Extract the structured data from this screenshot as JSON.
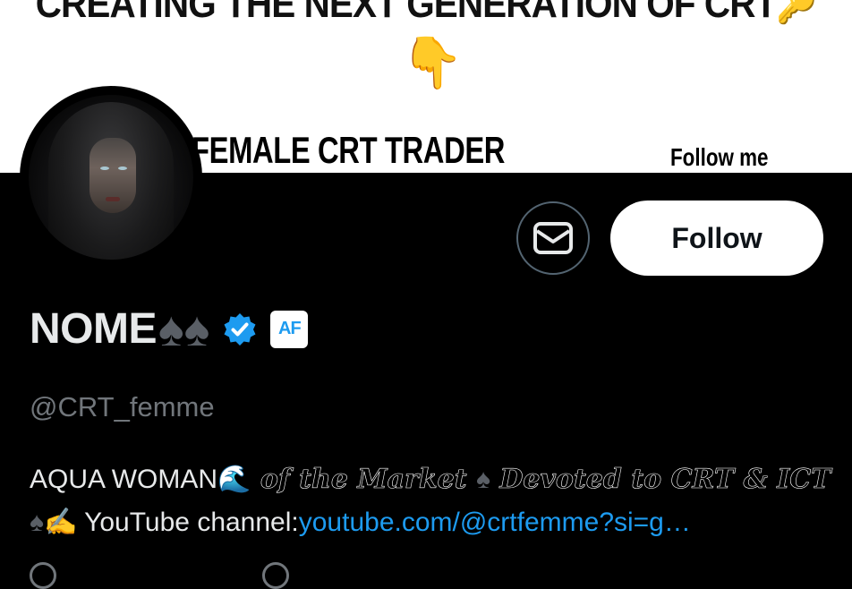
{
  "banner": {
    "headline": "CREATING THE NEXT GENERATION OF CRT",
    "headline_emoji": "🔑",
    "pointer_emoji": "👇",
    "subtitle": "FEMALE CRT TRADER",
    "follow_text": "Follow me"
  },
  "profile": {
    "name": "NOME",
    "name_suffix": "♠♠",
    "handle": "@CRT_femme",
    "affiliate_badge": "AF",
    "verified": true
  },
  "actions": {
    "follow_label": "Follow"
  },
  "bio": {
    "part1": "AQUA WOMAN",
    "wave_emoji": "🌊",
    "part2": " of the Market ",
    "spade1": "♠",
    "part3": " Devoted to CRT & ICT",
    "spade2": "♠",
    "writing_emoji": "✍",
    "part4": "  YouTube channel:",
    "link": "youtube.com/@crtfemme?si=g…"
  },
  "colors": {
    "background": "#000000",
    "accent": "#1d9bf0",
    "muted": "#71767b",
    "text": "#e7e9ea"
  },
  "icons": {
    "message": "envelope-icon",
    "verified": "verified-badge-icon"
  }
}
